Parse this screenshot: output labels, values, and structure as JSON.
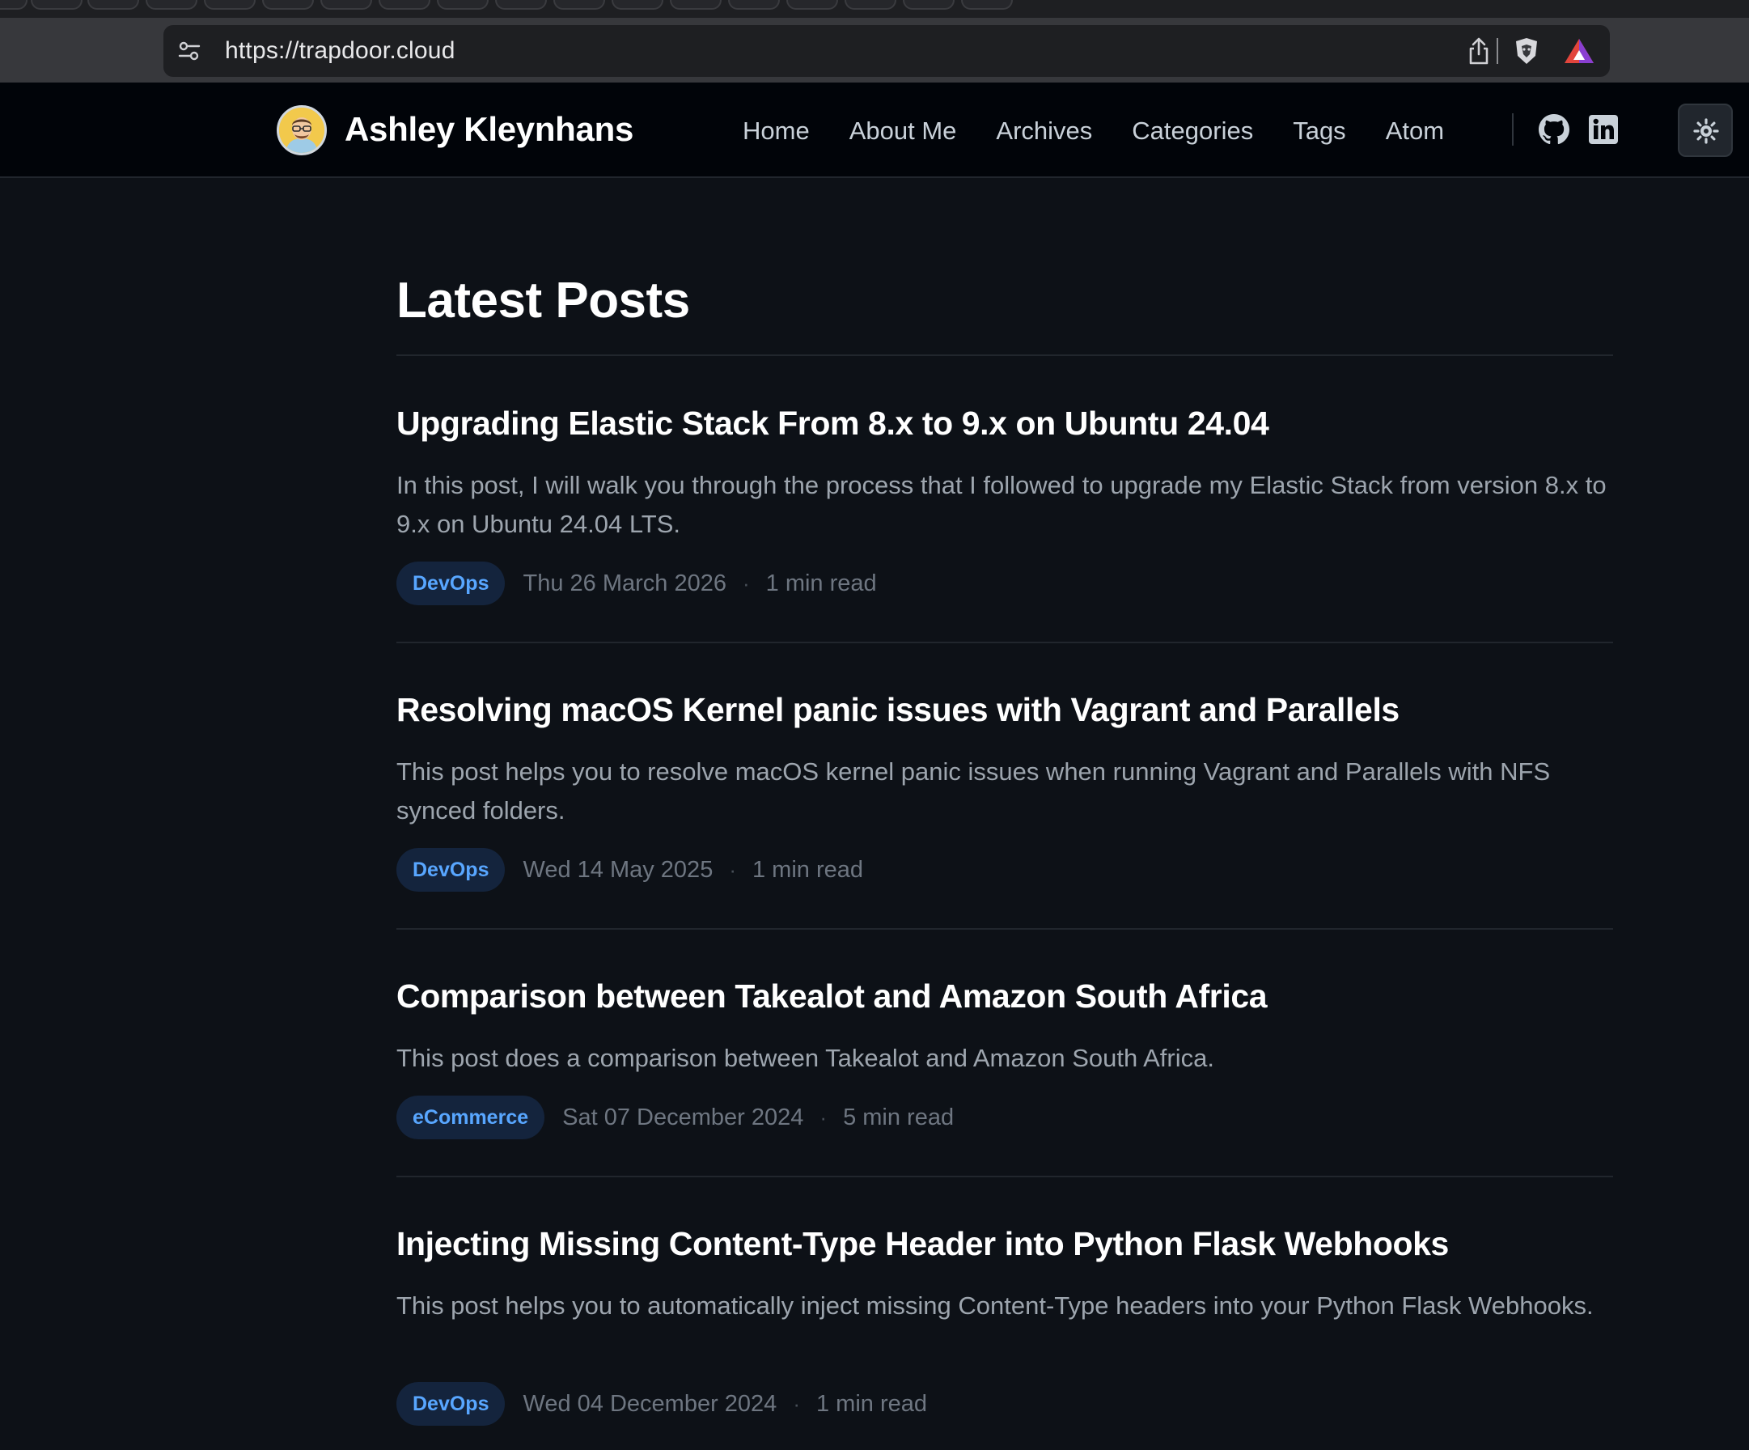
{
  "browser": {
    "url": "https://trapdoor.cloud"
  },
  "site": {
    "title": "Ashley Kleynhans",
    "nav": [
      "Home",
      "About Me",
      "Archives",
      "Categories",
      "Tags",
      "Atom"
    ],
    "social": [
      "github-icon",
      "linkedin-icon"
    ],
    "theme_toggle_icon": "sun-icon"
  },
  "page": {
    "heading": "Latest Posts",
    "posts": [
      {
        "title": "Upgrading Elastic Stack From 8.x to 9.x on Ubuntu 24.04",
        "summary": "In this post, I will walk you through the process that I followed to upgrade my Elastic Stack from version 8.x to 9.x on Ubuntu 24.04 LTS.",
        "category": "DevOps",
        "date": "Thu 26 March 2026",
        "read_time": "1 min read"
      },
      {
        "title": "Resolving macOS Kernel panic issues with Vagrant and Parallels",
        "summary": "This post helps you to resolve macOS kernel panic issues when running Vagrant and Parallels with NFS synced folders.",
        "category": "DevOps",
        "date": "Wed 14 May 2025",
        "read_time": "1 min read"
      },
      {
        "title": "Comparison between Takealot and Amazon South Africa",
        "summary": "This post does a comparison between Takealot and Amazon South Africa.",
        "category": "eCommerce",
        "date": "Sat 07 December 2024",
        "read_time": "5 min read"
      },
      {
        "title": "Injecting Missing Content-Type Header into Python Flask Webhooks",
        "summary": "This post helps you to automatically inject missing Content-Type headers into your Python Flask Webhooks.",
        "category": "DevOps",
        "date": "Wed 04 December 2024",
        "read_time": "1 min read"
      }
    ]
  },
  "colors": {
    "background": "#0d1117",
    "header_bg": "#010409",
    "badge_bg": "#14243d",
    "badge_text": "#58a6ff",
    "summary_text": "#9da5ae",
    "meta_text": "#6e7681"
  }
}
